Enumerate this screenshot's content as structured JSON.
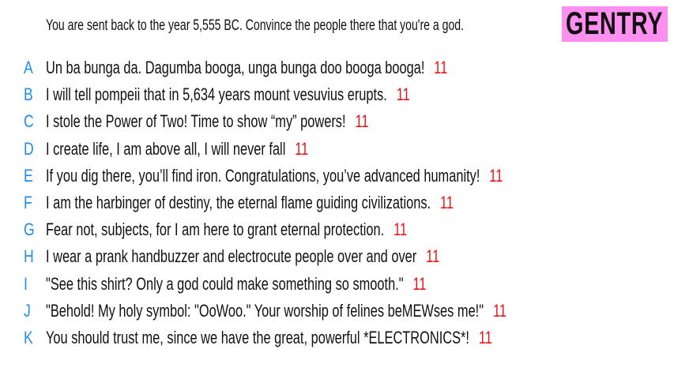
{
  "prompt": "You are sent back to the year 5,555 BC. Convince the people there that you're a god.",
  "badge": "GENTRY",
  "colors": {
    "letter": "#1e8cf0",
    "score": "#ee1111",
    "badge_bg": "#fc8ff0"
  },
  "answers": [
    {
      "letter": "A",
      "text": "Un ba bunga da. Dagumba booga, unga bunga doo booga booga!",
      "score": "11"
    },
    {
      "letter": "B",
      "text": "I will tell pompeii that in 5,634 years mount vesuvius erupts.",
      "score": "11"
    },
    {
      "letter": "C",
      "text": "I stole the Power of Two! Time to show “my” powers!",
      "score": "11"
    },
    {
      "letter": "D",
      "text": "I create life, I am above all, I will never fall",
      "score": "11"
    },
    {
      "letter": "E",
      "text": "If you dig there, you’ll find iron. Congratulations, you’ve advanced humanity!",
      "score": "11"
    },
    {
      "letter": "F",
      "text": "I am the harbinger of destiny, the eternal flame guiding civilizations.",
      "score": "11"
    },
    {
      "letter": "G",
      "text": "Fear not, subjects, for I am here to grant eternal protection.",
      "score": "11"
    },
    {
      "letter": "H",
      "text": "I wear a prank handbuzzer and electrocute people over and over",
      "score": "11"
    },
    {
      "letter": "I",
      "text": "\"See this shirt? Only a god could make something so smooth.\"",
      "score": "11"
    },
    {
      "letter": "J",
      "text": "\"Behold! My holy symbol: \"OoWoo.\" Your worship of felines beMEWses me!\"",
      "score": "11"
    },
    {
      "letter": "K",
      "text": "You should trust me, since we have the great, powerful *ELECTRONICS*!",
      "score": "11"
    }
  ]
}
